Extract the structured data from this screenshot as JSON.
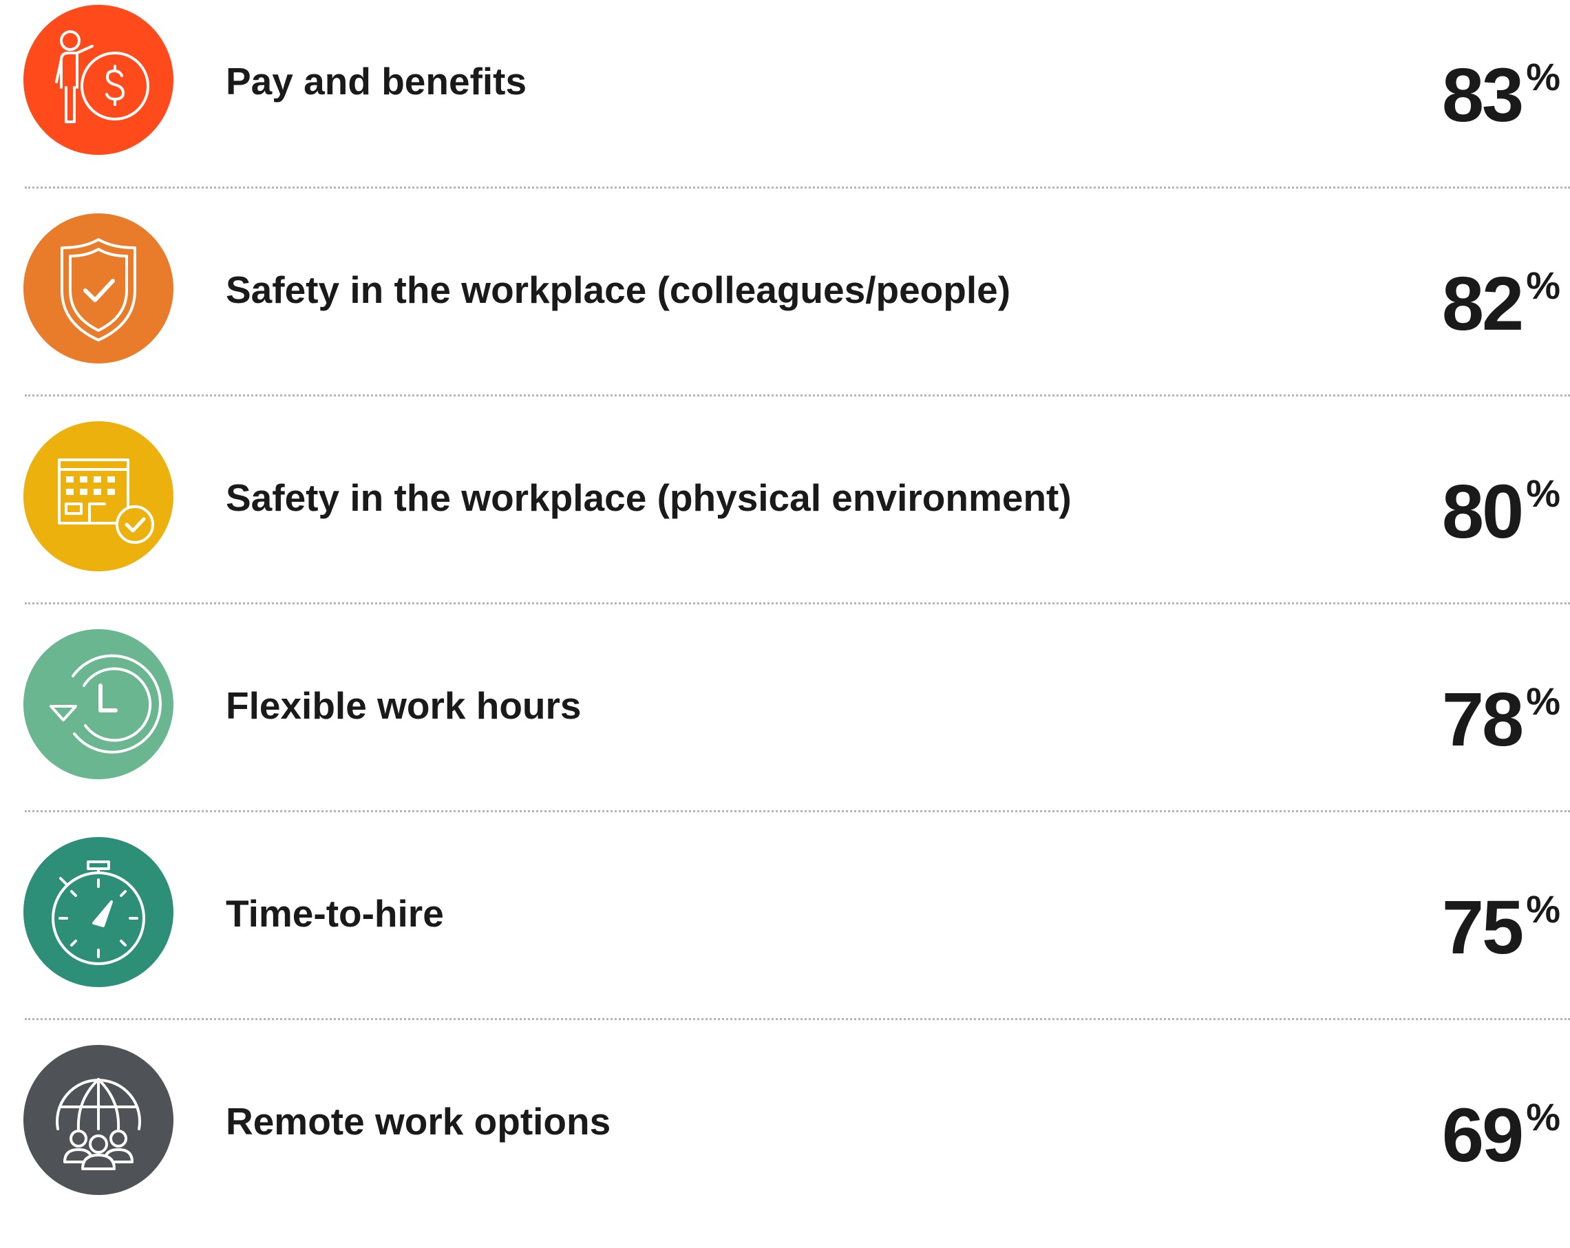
{
  "chart_data": {
    "type": "table",
    "unit": "%",
    "rows": [
      {
        "label": "Pay and benefits",
        "value": 83,
        "value_text": "83",
        "pct": "%",
        "color": "#FF4A1C",
        "icon": "person-with-coin-icon"
      },
      {
        "label": "Safety in the workplace (colleagues/people)",
        "value": 82,
        "value_text": "82",
        "pct": "%",
        "color": "#E97C2B",
        "icon": "shield-check-icon"
      },
      {
        "label": "Safety in the workplace (physical environment)",
        "value": 80,
        "value_text": "80",
        "pct": "%",
        "color": "#EDB10E",
        "icon": "building-check-icon"
      },
      {
        "label": "Flexible work hours",
        "value": 78,
        "value_text": "78",
        "pct": "%",
        "color": "#6AB691",
        "icon": "clock-history-icon"
      },
      {
        "label": "Time-to-hire",
        "value": 75,
        "value_text": "75",
        "pct": "%",
        "color": "#2D8F78",
        "icon": "stopwatch-icon"
      },
      {
        "label": "Remote work options",
        "value": 69,
        "value_text": "69",
        "pct": "%",
        "color": "#4F5257",
        "icon": "globe-people-icon"
      }
    ]
  }
}
